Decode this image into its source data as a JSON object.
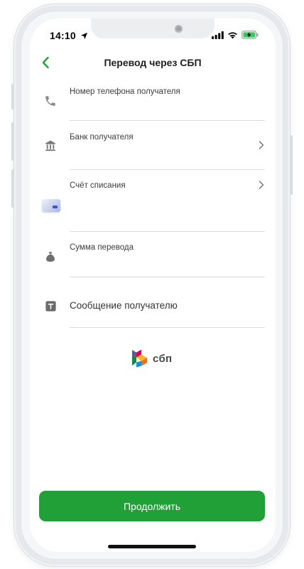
{
  "status_bar": {
    "time": "14:10",
    "icons": [
      "location-arrow-icon",
      "signal-icon",
      "wifi-icon",
      "battery-charging-icon"
    ]
  },
  "header": {
    "back_icon": "chevron-left-icon",
    "title": "Перевод через СБП"
  },
  "form": {
    "phone": {
      "label": "Номер телефона получателя",
      "icon": "phone-icon"
    },
    "bank": {
      "label": "Банк получателя",
      "icon": "bank-icon"
    },
    "account": {
      "label": "Счёт списания",
      "icon": "card-icon"
    },
    "amount": {
      "label": "Сумма перевода",
      "icon": "money-bag-icon"
    },
    "message": {
      "label": "Сообщение получателю",
      "icon": "text-box-icon"
    }
  },
  "sbp_logo": {
    "text": "сбп"
  },
  "continue_button": {
    "label": "Продолжить"
  },
  "colors": {
    "accent_green": "#21a038",
    "icon_gray": "#7a7a7a",
    "divider": "#dcdcdc"
  }
}
